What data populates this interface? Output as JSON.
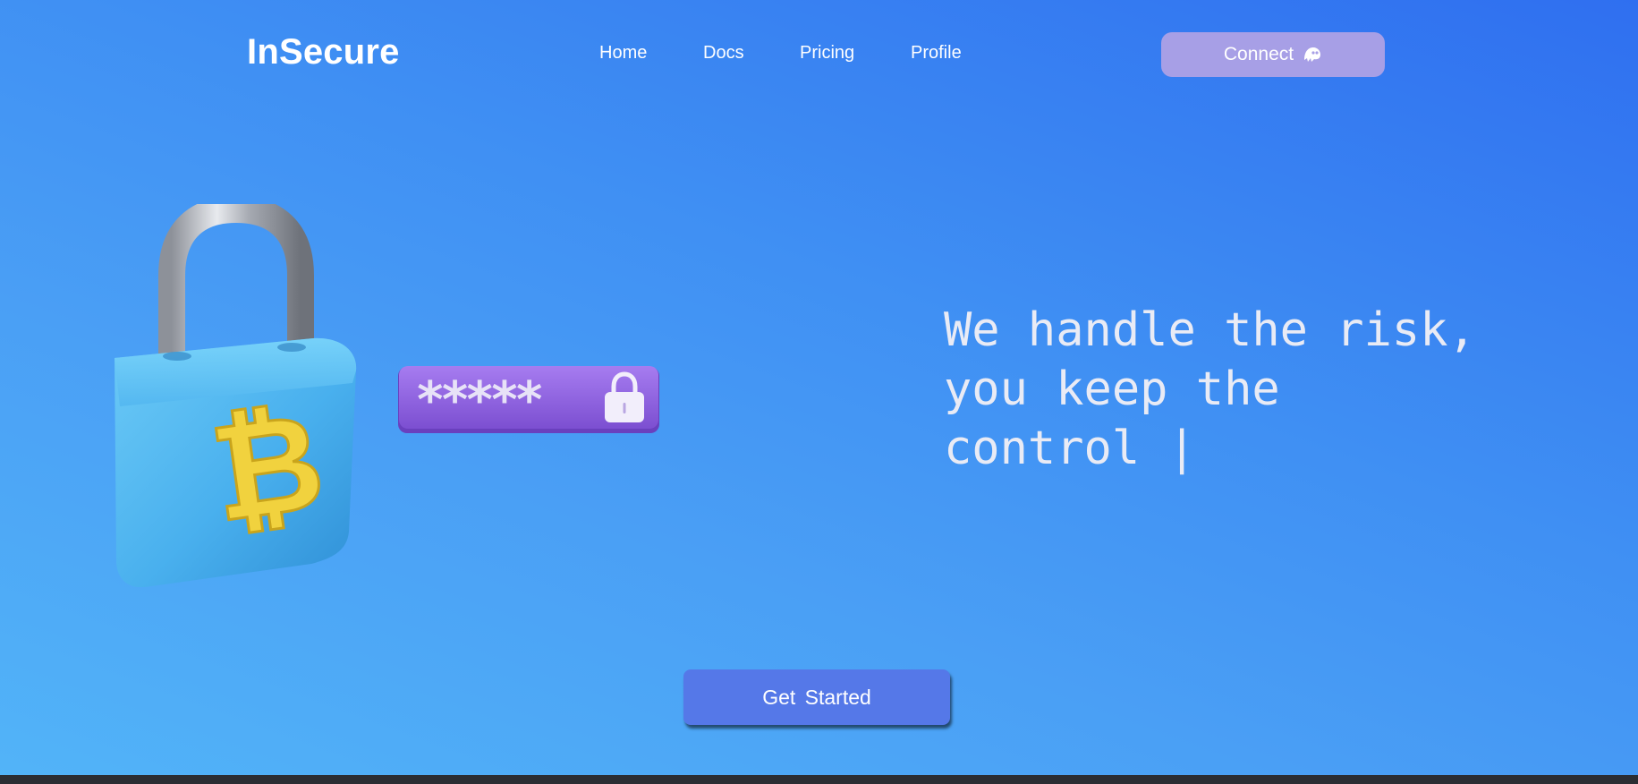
{
  "brand": {
    "name": "InSecure"
  },
  "nav": {
    "items": [
      {
        "label": "Home"
      },
      {
        "label": "Docs"
      },
      {
        "label": "Pricing"
      },
      {
        "label": "Profile"
      }
    ]
  },
  "connect": {
    "label": "Connect",
    "icon": "ghost-icon"
  },
  "hero": {
    "headline": "We handle the risk,\nyou keep the\ncontrol |",
    "illustration": {
      "lock_icon": "bitcoin-padlock-icon",
      "symbol": "₿",
      "password_mask": "*****",
      "password_icon": "small-lock-icon"
    }
  },
  "cta": {
    "label": "Get  Started"
  },
  "colors": {
    "background_start": "#52b4f8",
    "background_end": "#2f6ff0",
    "connect_button": "#a79fe6",
    "cta_button": "#5578e8",
    "padlock_body": "#4eb3ef",
    "bitcoin_symbol": "#f1d23e",
    "password_pill": "#8d5fdc"
  }
}
